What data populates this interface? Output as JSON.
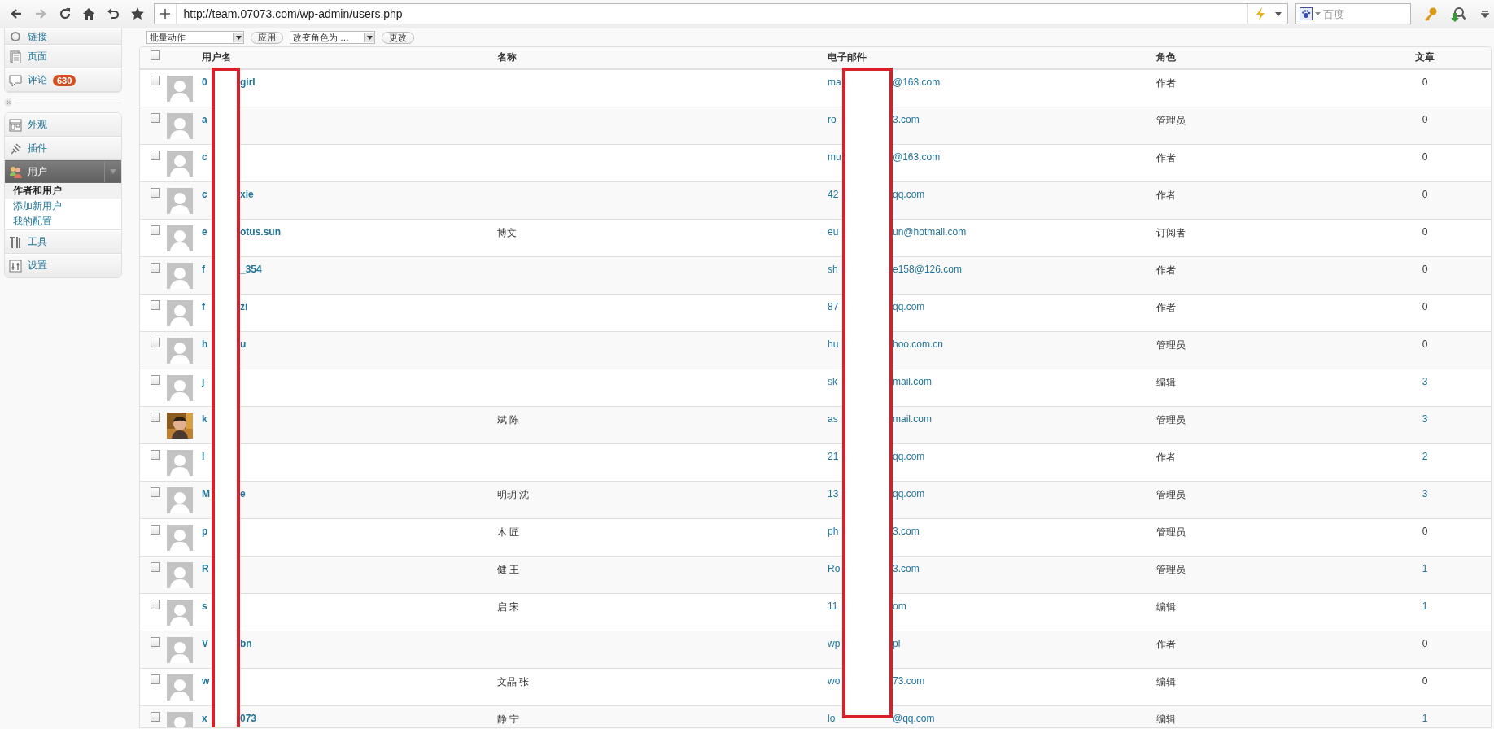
{
  "browser": {
    "url": "http://team.07073.com/wp-admin/users.php",
    "search_placeholder": "百度",
    "forward_disabled": true
  },
  "sidebar": {
    "groups": [
      {
        "items": [
          {
            "label": "链接",
            "expanded": false
          },
          {
            "label": "页面",
            "expanded": false
          },
          {
            "label": "评论",
            "badge": "630",
            "expanded": false
          }
        ]
      },
      {
        "items": [
          {
            "label": "外观",
            "expanded": false
          },
          {
            "label": "插件",
            "expanded": false
          },
          {
            "label": "用户",
            "expanded": true,
            "children": [
              {
                "label": "作者和用户",
                "selected": true
              },
              {
                "label": "添加新用户",
                "selected": false
              },
              {
                "label": "我的配置",
                "selected": false
              }
            ]
          },
          {
            "label": "工具",
            "expanded": false
          },
          {
            "label": "设置",
            "expanded": false
          }
        ]
      }
    ]
  },
  "bulk_actions": {
    "action_select": "批量动作",
    "apply_button": "应用",
    "role_select": "改变角色为 …",
    "change_button": "更改"
  },
  "table": {
    "select_all_checked": false,
    "columns": [
      "用户名",
      "名称",
      "电子邮件",
      "角色",
      "文章"
    ],
    "rows": [
      {
        "checked": false,
        "avatar": {
          "kind": "default"
        },
        "username_start": "0",
        "username_end": "girl",
        "email_start": "ma",
        "email_end": "@163.com",
        "role": "作者",
        "posts": "0",
        "posts_link": false
      },
      {
        "checked": false,
        "avatar": {
          "kind": "default"
        },
        "username_start": "a",
        "email_start": "ro",
        "email_end": "3.com",
        "role": "管理员",
        "posts": "0",
        "posts_link": false
      },
      {
        "checked": false,
        "avatar": {
          "kind": "default"
        },
        "username_start": "c",
        "email_start": "mu",
        "email_end": "@163.com",
        "role": "作者",
        "posts": "0",
        "posts_link": false
      },
      {
        "checked": false,
        "avatar": {
          "kind": "default"
        },
        "username_start": "c",
        "username_end": "xie",
        "email_start": "42",
        "email_end": "qq.com",
        "role": "作者",
        "posts": "0",
        "posts_link": false
      },
      {
        "checked": false,
        "avatar": {
          "kind": "default"
        },
        "username_start": "e",
        "username_end": "otus.sun",
        "name": "博文",
        "email_start": "eu",
        "email_end": "un@hotmail.com",
        "role": "订阅者",
        "posts": "0",
        "posts_link": false
      },
      {
        "checked": false,
        "avatar": {
          "kind": "default"
        },
        "username_start": "f",
        "username_end": "_354",
        "email_start": "sh",
        "email_end": "e158@126.com",
        "role": "作者",
        "posts": "0",
        "posts_link": false
      },
      {
        "checked": false,
        "avatar": {
          "kind": "default"
        },
        "username_start": "f",
        "username_end": "zi",
        "email_start": "87",
        "email_end": "qq.com",
        "role": "作者",
        "posts": "0",
        "posts_link": false
      },
      {
        "checked": false,
        "avatar": {
          "kind": "default"
        },
        "username_start": "h",
        "username_end": "u",
        "email_start": "hu",
        "email_end": "hoo.com.cn",
        "role": "管理员",
        "posts": "0",
        "posts_link": false
      },
      {
        "checked": false,
        "avatar": {
          "kind": "default"
        },
        "username_start": "j",
        "email_start": "sk",
        "email_end": "mail.com",
        "role": "编辑",
        "posts": "3",
        "posts_link": true
      },
      {
        "checked": false,
        "username_start": "k",
        "name": "斌 陈",
        "email_start": "as",
        "email_end": "mail.com",
        "role": "管理员",
        "posts": "3",
        "posts_link": true
      },
      {
        "checked": false,
        "avatar": {
          "kind": "default"
        },
        "username_start": "l",
        "email_start": "21",
        "email_end": "qq.com",
        "role": "作者",
        "posts": "2",
        "posts_link": true
      },
      {
        "checked": false,
        "avatar": {
          "kind": "default"
        },
        "username_start": "M",
        "username_end": "e",
        "name": "明玥 沈",
        "email_start": "13",
        "email_end": "qq.com",
        "role": "管理员",
        "posts": "3",
        "posts_link": true
      },
      {
        "checked": false,
        "avatar": {
          "kind": "default"
        },
        "username_start": "p",
        "name": "木 匠",
        "email_start": "ph",
        "email_end": "3.com",
        "role": "管理员",
        "posts": "0",
        "posts_link": false
      },
      {
        "checked": false,
        "avatar": {
          "kind": "default"
        },
        "username_start": "R",
        "name": "健 王",
        "email_start": "Ro",
        "email_end": "3.com",
        "role": "管理员",
        "posts": "1",
        "posts_link": true
      },
      {
        "checked": false,
        "avatar": {
          "kind": "default"
        },
        "username_start": "s",
        "name": "启 宋",
        "email_start": "11",
        "email_end": "om",
        "role": "编辑",
        "posts": "1",
        "posts_link": true
      },
      {
        "checked": false,
        "avatar": {
          "kind": "default"
        },
        "username_start": "V",
        "username_end": "bn",
        "email_start": "wp",
        "email_end": "pl",
        "role": "作者",
        "posts": "0",
        "posts_link": false
      },
      {
        "checked": false,
        "avatar": {
          "kind": "default"
        },
        "username_start": "w",
        "name": "文晶 张",
        "email_start": "wo",
        "email_end": "73.com",
        "role": "编辑",
        "posts": "0",
        "posts_link": false
      },
      {
        "checked": false,
        "avatar": {
          "kind": "default"
        },
        "username_start": "x",
        "username_end": "073",
        "name": "静 宁",
        "email_start": "lo",
        "email_end": "@qq.com",
        "role": "编辑",
        "posts": "1",
        "posts_link": true
      }
    ]
  },
  "redactions": {
    "username_column": true,
    "email_column": true
  }
}
